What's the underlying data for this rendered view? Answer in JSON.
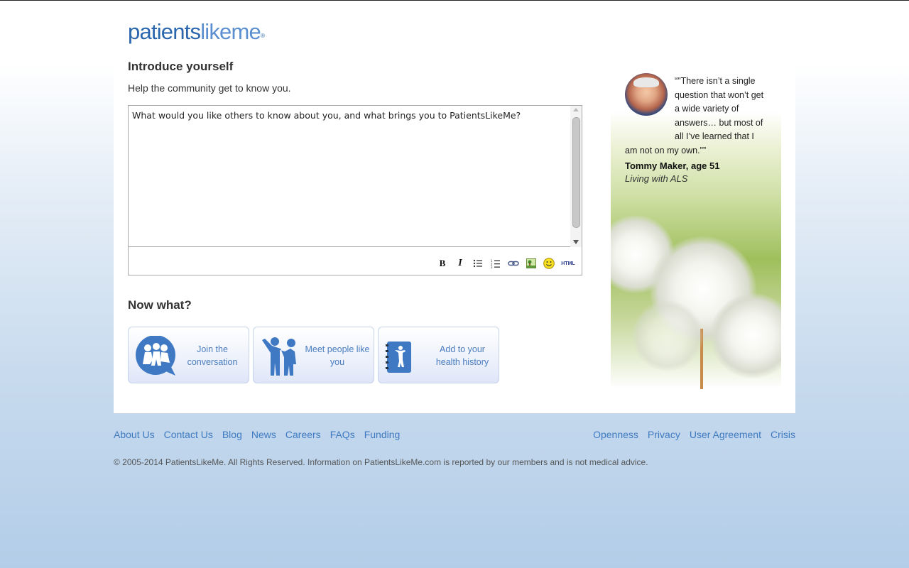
{
  "brand": {
    "logo_part1": "patients",
    "logo_part2": "likeme",
    "logo_mark": "®"
  },
  "intro": {
    "heading": "Introduce yourself",
    "subheading": "Help the community get to know you.",
    "textarea_value": "What would you like others to know about you, and what brings you to PatientsLikeMe?"
  },
  "toolbar": {
    "bold": "B",
    "italic": "I",
    "html": "HTML"
  },
  "now_what": {
    "heading": "Now what?",
    "cards": [
      {
        "label": "Join the conversation"
      },
      {
        "label": "Meet people like you"
      },
      {
        "label": "Add to your health history"
      }
    ]
  },
  "testimonial": {
    "quote": "“\"There isn’t a single question that won’t get a wide variety of answers… but most of all I’ve learned that I am not on my own.\"”",
    "author": "Tommy Maker, age 51",
    "condition": "Living with ALS"
  },
  "footer": {
    "left_links": [
      "About Us",
      "Contact Us",
      "Blog",
      "News",
      "Careers",
      "FAQs",
      "Funding"
    ],
    "right_links": [
      "Openness",
      "Privacy",
      "User Agreement",
      "Crisis"
    ],
    "copyright": "© 2005-2014 PatientsLikeMe. All Rights Reserved. Information on PatientsLikeMe.com is reported by our members and is not medical advice."
  },
  "colors": {
    "brand_blue": "#2c6db5",
    "link_blue": "#3e7ac2",
    "card_text": "#4a7dc0"
  }
}
